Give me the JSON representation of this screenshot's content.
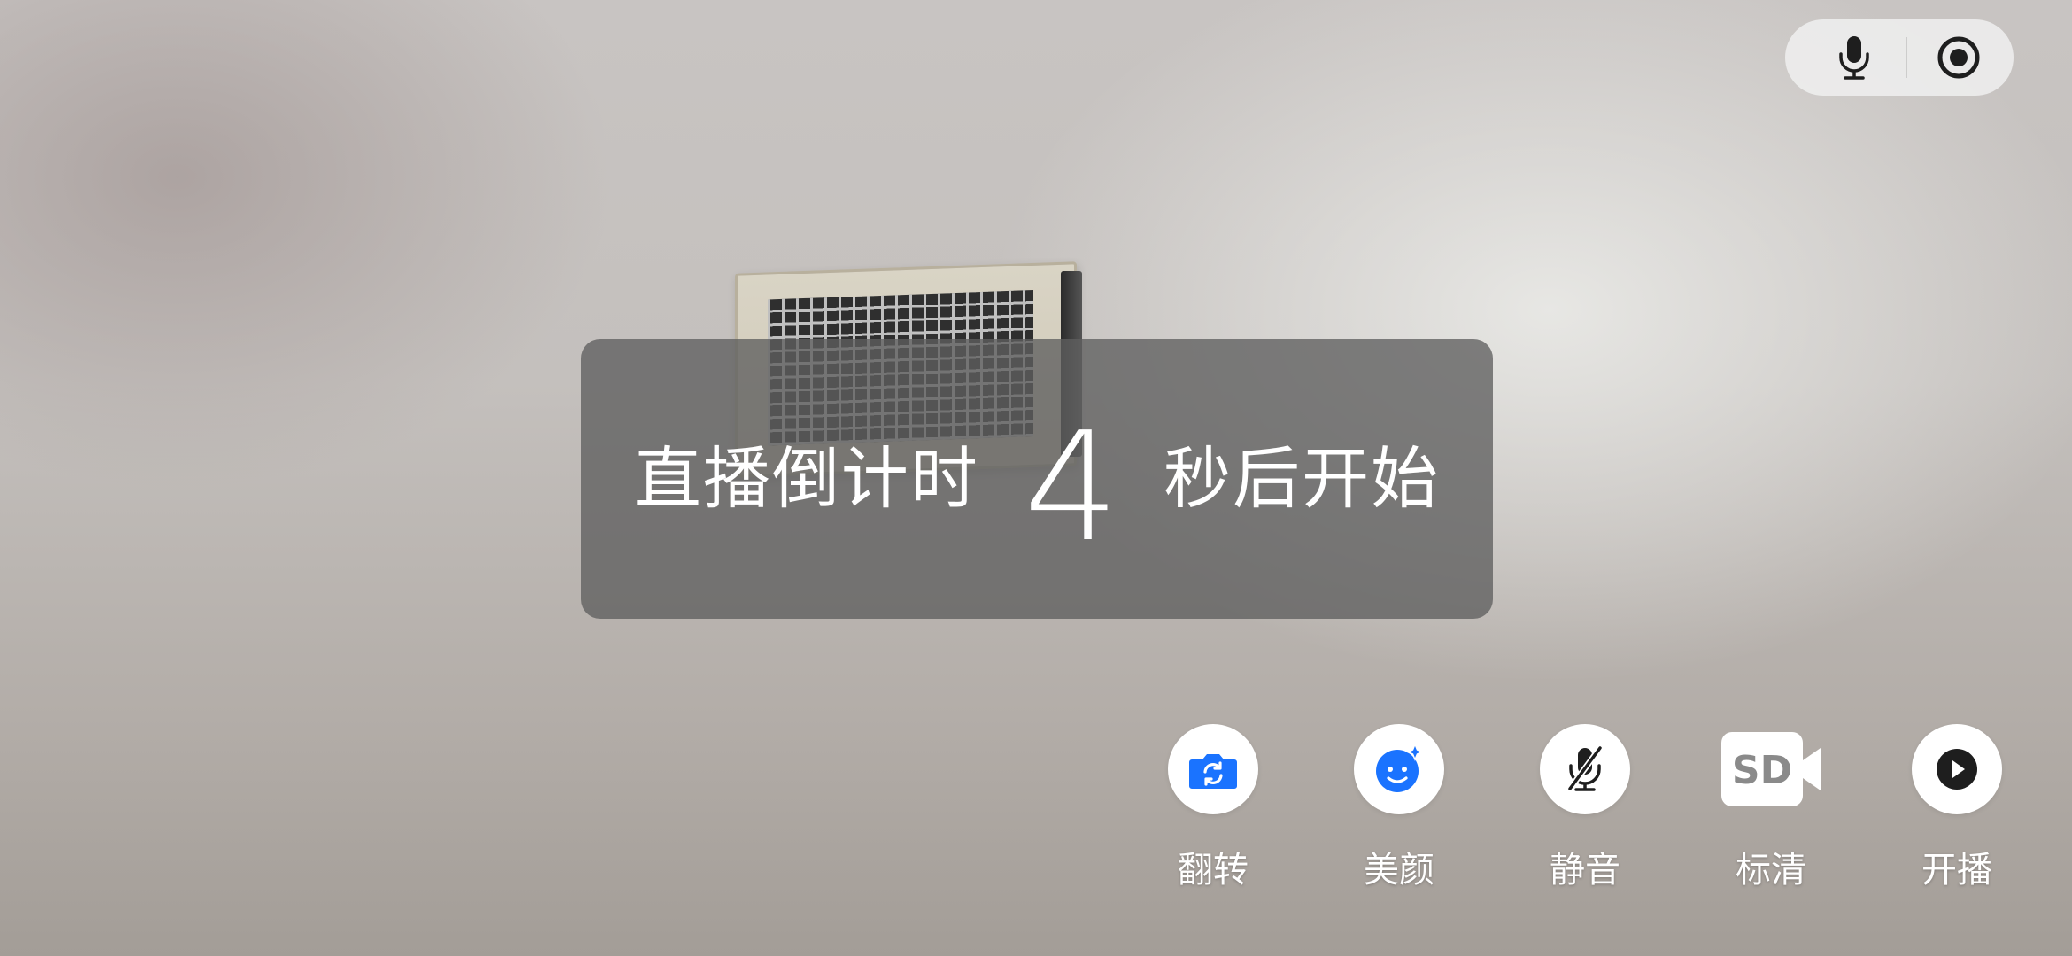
{
  "countdown": {
    "prefix": "直播倒计时",
    "number": "4",
    "suffix": "秒后开始"
  },
  "top_bar": {
    "icons": [
      "microphone-icon",
      "record-icon"
    ]
  },
  "controls": [
    {
      "id": "flip",
      "label": "翻转",
      "icon": "camera-flip-icon"
    },
    {
      "id": "beauty",
      "label": "美颜",
      "icon": "beauty-face-icon"
    },
    {
      "id": "mute",
      "label": "静音",
      "icon": "mic-off-icon"
    },
    {
      "id": "quality",
      "label": "标清",
      "icon": "sd-camera-icon"
    },
    {
      "id": "start",
      "label": "开播",
      "icon": "play-icon"
    }
  ],
  "colors": {
    "accent_blue": "#1a73ff",
    "overlay": "#5f5f5f",
    "icon_dark": "#1e1e1e"
  }
}
